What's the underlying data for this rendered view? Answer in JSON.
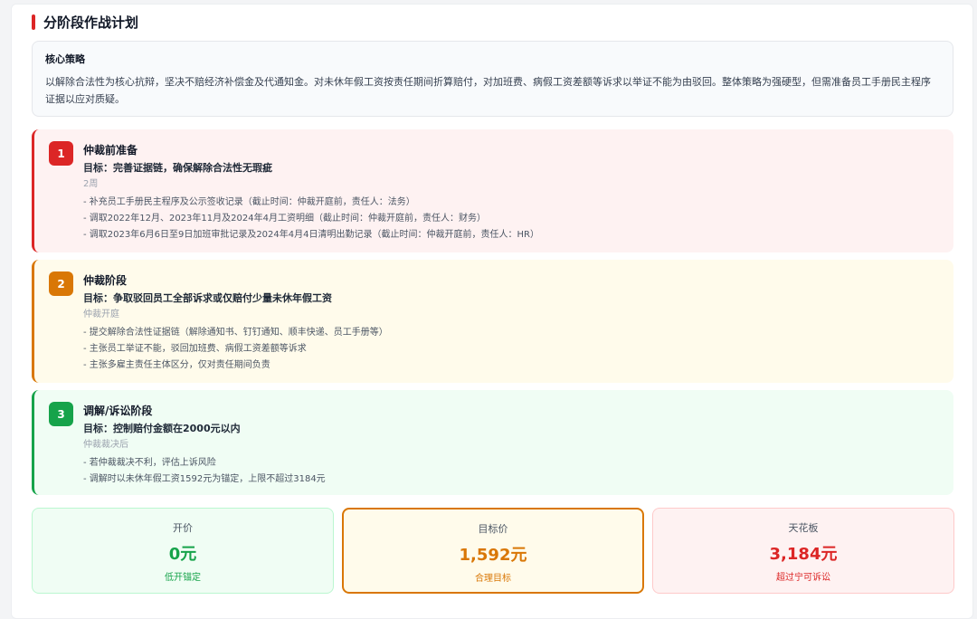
{
  "section": {
    "title": "分阶段作战计划"
  },
  "strategy": {
    "heading": "核心策略",
    "text": "以解除合法性为核心抗辩，坚决不赔经济补偿金及代通知金。对未休年假工资按责任期间折算赔付，对加班费、病假工资差额等诉求以举证不能为由驳回。整体策略为强硬型，但需准备员工手册民主程序证据以应对质疑。"
  },
  "phases": [
    {
      "number": "1",
      "name": "仲裁前准备",
      "goal": "目标：完善证据链，确保解除合法性无瑕疵",
      "duration": "2周",
      "items": [
        "- 补充员工手册民主程序及公示签收记录（截止时间：仲裁开庭前，责任人：法务）",
        "- 调取2022年12月、2023年11月及2024年4月工资明细（截止时间：仲裁开庭前，责任人：财务）",
        "- 调取2023年6月6日至9日加班审批记录及2024年4月4日清明出勤记录（截止时间：仲裁开庭前，责任人：HR）"
      ]
    },
    {
      "number": "2",
      "name": "仲裁阶段",
      "goal": "目标：争取驳回员工全部诉求或仅赔付少量未休年假工资",
      "duration": "仲裁开庭",
      "items": [
        "- 提交解除合法性证据链（解除通知书、钉钉通知、顺丰快递、员工手册等）",
        "- 主张员工举证不能，驳回加班费、病假工资差额等诉求",
        "- 主张多雇主责任主体区分，仅对责任期间负责"
      ]
    },
    {
      "number": "3",
      "name": "调解/诉讼阶段",
      "goal": "目标：控制赔付金额在2000元以内",
      "duration": "仲裁裁决后",
      "items": [
        "- 若仲裁裁决不利，评估上诉风险",
        "- 调解时以未休年假工资1592元为锚定，上限不超过3184元"
      ]
    }
  ],
  "prices": {
    "open": {
      "label": "开价",
      "value": "0元",
      "note": "低开锚定"
    },
    "target": {
      "label": "目标价",
      "value": "1,592元",
      "note": "合理目标"
    },
    "ceiling": {
      "label": "天花板",
      "value": "3,184元",
      "note": "超过宁可诉讼"
    }
  },
  "colors": {
    "phase1": "#dc2626",
    "phase2": "#d97706",
    "phase3": "#16a34a"
  }
}
